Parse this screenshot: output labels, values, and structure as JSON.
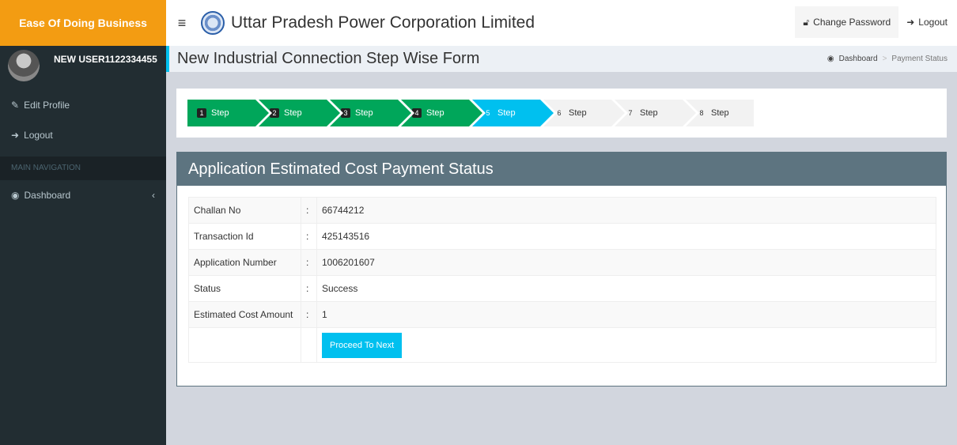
{
  "brand": "Ease Of Doing Business",
  "corp_title": "Uttar Pradesh Power Corporation Limited",
  "top": {
    "change_password": "Change Password",
    "logout": "Logout"
  },
  "sidebar": {
    "username": "NEW USER1122334455",
    "edit_profile": "Edit Profile",
    "logout": "Logout",
    "section": "MAIN NAVIGATION",
    "dashboard": "Dashboard"
  },
  "content_title": "New Industrial Connection Step Wise Form",
  "breadcrumb": {
    "home": "Dashboard",
    "current": "Payment Status"
  },
  "steps": [
    {
      "num": "1",
      "label": "Step"
    },
    {
      "num": "2",
      "label": "Step"
    },
    {
      "num": "3",
      "label": "Step"
    },
    {
      "num": "4",
      "label": "Step"
    },
    {
      "num": "5",
      "label": "Step"
    },
    {
      "num": "6",
      "label": "Step"
    },
    {
      "num": "7",
      "label": "Step"
    },
    {
      "num": "8",
      "label": "Step"
    }
  ],
  "box_title": "Application Estimated Cost Payment Status",
  "rows": [
    {
      "label": "Challan No",
      "colon": ":",
      "value": "66744212"
    },
    {
      "label": "Transaction Id",
      "colon": ":",
      "value": "425143516"
    },
    {
      "label": "Application Number",
      "colon": ":",
      "value": "1006201607"
    },
    {
      "label": "Status",
      "colon": ":",
      "value": "Success"
    },
    {
      "label": "Estimated Cost Amount",
      "colon": ":",
      "value": "1"
    }
  ],
  "proceed_label": "Proceed To Next",
  "colors": {
    "brand": "#f39c12",
    "sidebar": "#222d32",
    "step_done": "#00a65a",
    "step_active": "#00c0ef",
    "box_header": "#5d7480"
  }
}
